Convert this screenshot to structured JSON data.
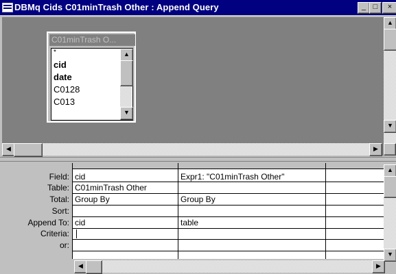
{
  "window": {
    "title": "DBMq Cids C01minTrash Other : Append Query",
    "minimize_glyph": "_",
    "restore_glyph": "□",
    "close_glyph": "×"
  },
  "field_list": {
    "title": "C01minTrash O...",
    "items": [
      "*",
      "cid",
      "date",
      "C0128",
      "C013"
    ],
    "bold_items": [
      "cid",
      "date"
    ]
  },
  "grid": {
    "row_labels": [
      "Field:",
      "Table:",
      "Total:",
      "Sort:",
      "Append To:",
      "Criteria:",
      "or:"
    ],
    "columns": [
      {
        "field": "cid",
        "table": "C01minTrash Other",
        "total": "Group By",
        "sort": "",
        "append_to": "cid",
        "criteria": "",
        "or": ""
      },
      {
        "field": "Expr1: \"C01minTrash Other\"",
        "table": "",
        "total": "Group By",
        "sort": "",
        "append_to": "table",
        "criteria": "",
        "or": ""
      },
      {
        "field": "",
        "table": "",
        "total": "",
        "sort": "",
        "append_to": "",
        "criteria": "",
        "or": ""
      }
    ]
  },
  "icons": {
    "window": "query-window-icon",
    "scroll_up": "▲",
    "scroll_down": "▼",
    "scroll_left": "◀",
    "scroll_right": "▶"
  }
}
